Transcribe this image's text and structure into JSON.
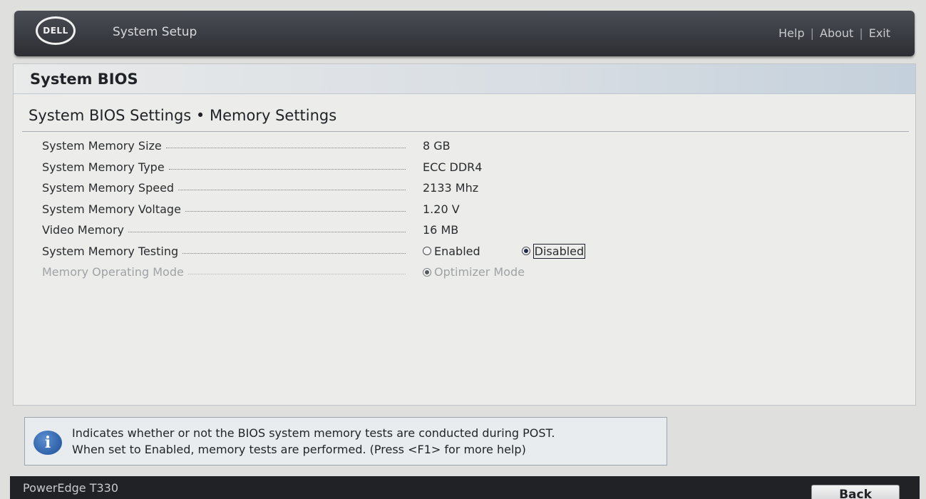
{
  "header": {
    "logo_text": "DELL",
    "app_title": "System Setup",
    "links": [
      "Help",
      "About",
      "Exit"
    ],
    "separator": "|"
  },
  "panel": {
    "title": "System BIOS",
    "section_title": "System BIOS Settings • Memory Settings"
  },
  "settings": [
    {
      "label": "System Memory Size",
      "value": "8 GB"
    },
    {
      "label": "System Memory Type",
      "value": "ECC DDR4"
    },
    {
      "label": "System Memory Speed",
      "value": "2133 Mhz"
    },
    {
      "label": "System Memory Voltage",
      "value": "1.20 V"
    },
    {
      "label": "Video Memory",
      "value": "16 MB"
    },
    {
      "label": "System Memory Testing",
      "options": [
        "Enabled",
        "Disabled"
      ],
      "selected": "Disabled"
    },
    {
      "label": "Memory Operating Mode",
      "options": [
        "Optimizer Mode"
      ],
      "selected": "Optimizer Mode",
      "disabled": true
    }
  ],
  "help": {
    "icon": "info-icon",
    "line1": "Indicates whether or not the BIOS system memory tests are conducted during POST.",
    "line2": "When set to Enabled, memory tests are performed. (Press <F1> for more help)"
  },
  "footer": {
    "model": "PowerEdge T330",
    "back_label": "Back"
  },
  "colors": {
    "header_bg": "#2c2e33",
    "panel_bg": "#ececea",
    "radio_selected": "#1e2b4a",
    "info_icon": "#1b4d9a"
  }
}
